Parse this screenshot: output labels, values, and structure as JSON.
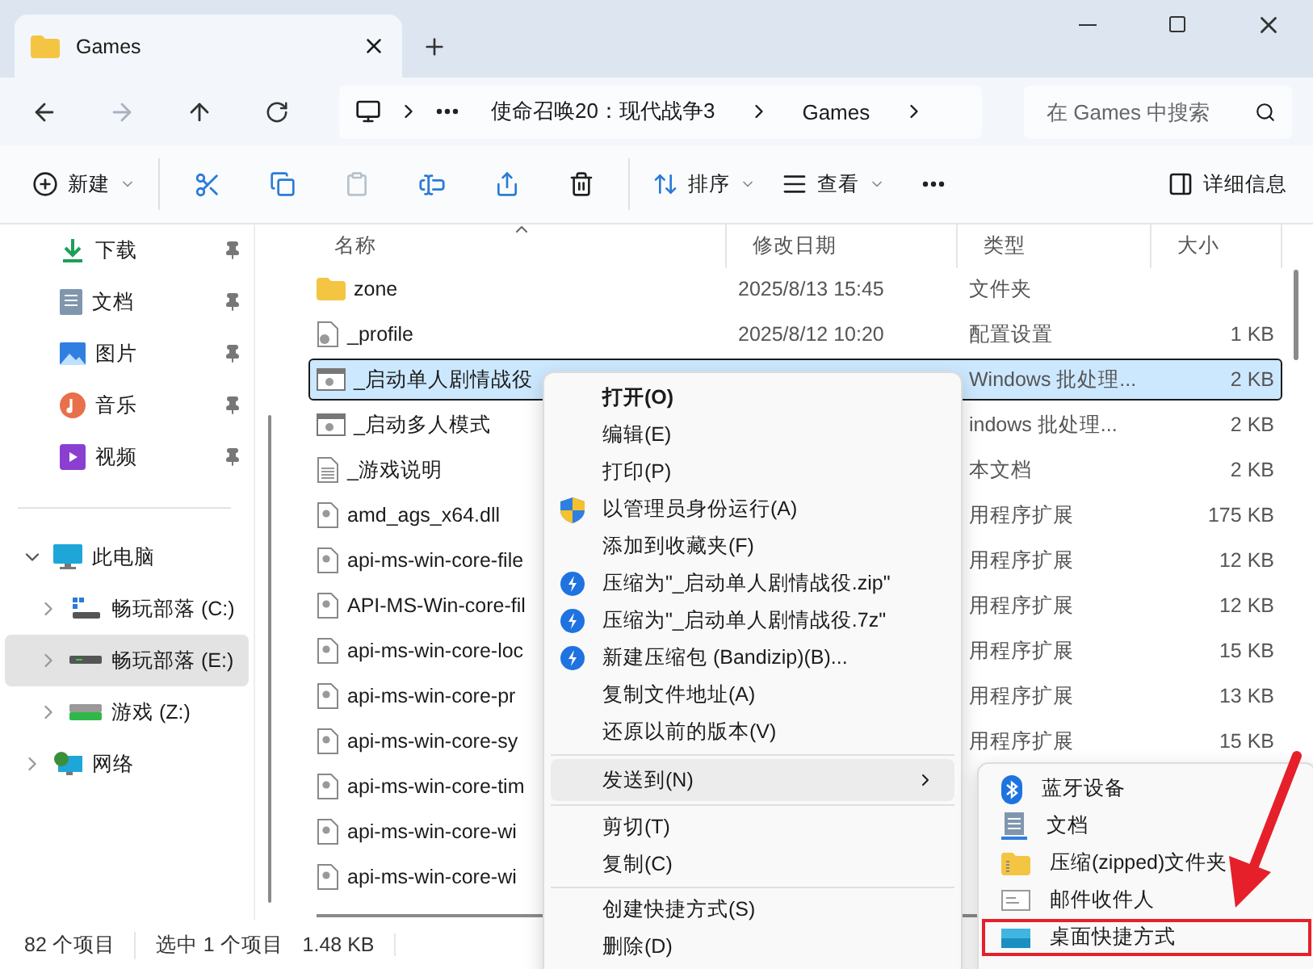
{
  "window": {
    "tabs": [
      {
        "title": "Games",
        "selected": true
      }
    ]
  },
  "nav_buttons": [
    {
      "kind": "back",
      "disabled": false
    },
    {
      "kind": "forward",
      "disabled": true
    },
    {
      "kind": "up",
      "disabled": false
    },
    {
      "kind": "refresh",
      "disabled": false
    }
  ],
  "address": {
    "path": [
      "使命召唤20：现代战争3",
      "Games"
    ]
  },
  "search": {
    "placeholder": "在 Games 中搜索"
  },
  "toolbar": {
    "items": [
      {
        "kind": "new",
        "label": "新建",
        "dropdown": true,
        "disabled": false
      },
      {
        "kind": "separator"
      },
      {
        "kind": "cut",
        "disabled": false
      },
      {
        "kind": "copy",
        "disabled": false
      },
      {
        "kind": "paste",
        "disabled": true
      },
      {
        "kind": "rename",
        "disabled": false
      },
      {
        "kind": "share",
        "disabled": false
      },
      {
        "kind": "delete",
        "disabled": false
      },
      {
        "kind": "separator"
      },
      {
        "kind": "sort",
        "label": "排序",
        "dropdown": true,
        "disabled": false
      },
      {
        "kind": "view",
        "label": "查看",
        "dropdown": true,
        "disabled": false
      },
      {
        "kind": "more",
        "disabled": false
      }
    ],
    "details": "详细信息"
  },
  "sidebar": {
    "quick_access": [
      {
        "label": "下载",
        "kind": "download",
        "pinned": true
      },
      {
        "label": "文档",
        "kind": "documents",
        "pinned": true
      },
      {
        "label": "图片",
        "kind": "pictures",
        "pinned": true
      },
      {
        "label": "音乐",
        "kind": "music",
        "pinned": true
      },
      {
        "label": "视频",
        "kind": "video",
        "pinned": true
      }
    ],
    "tree": [
      {
        "label": "此电脑",
        "kind": "pc",
        "expanded": true,
        "selected": false,
        "children": [
          {
            "label": "畅玩部落 (C:)",
            "kind": "system-drive",
            "expanded": false,
            "selected": false
          },
          {
            "label": "畅玩部落 (E:)",
            "kind": "drive",
            "expanded": false,
            "selected": true
          },
          {
            "label": "游戏 (Z:)",
            "kind": "green-drive",
            "expanded": false,
            "selected": false
          }
        ]
      },
      {
        "label": "网络",
        "kind": "network",
        "expanded": false,
        "selected": false
      }
    ]
  },
  "files": {
    "columns": [
      {
        "label": "名称",
        "sorted": true
      },
      {
        "label": "修改日期",
        "sorted": false
      },
      {
        "label": "类型",
        "sorted": false
      },
      {
        "label": "大小",
        "sorted": false
      }
    ],
    "rows": [
      {
        "name": "zone",
        "kind": "folder",
        "date": "2025/8/13 15:45",
        "type": "文件夹",
        "selected": false
      },
      {
        "name": "_profile",
        "kind": "settings",
        "date": "2025/8/12 10:20",
        "type": "配置设置",
        "size": "1 KB",
        "selected": false
      },
      {
        "name": "_启动单人剧情战役",
        "kind": "batch",
        "type": "Windows 批处理...",
        "size": "2 KB",
        "selected": true
      },
      {
        "name": "_启动多人模式",
        "kind": "batch",
        "type": "indows 批处理...",
        "size": "2 KB",
        "selected": false
      },
      {
        "name": "_游戏说明",
        "kind": "text",
        "type": "本文档",
        "size": "2 KB",
        "selected": false
      },
      {
        "name": "amd_ags_x64.dll",
        "kind": "dll",
        "type": "用程序扩展",
        "size": "175 KB",
        "selected": false
      },
      {
        "name": "api-ms-win-core-file",
        "kind": "dll",
        "type": "用程序扩展",
        "size": "12 KB",
        "selected": false
      },
      {
        "name": "API-MS-Win-core-fil",
        "kind": "dll",
        "type": "用程序扩展",
        "size": "12 KB",
        "selected": false
      },
      {
        "name": "api-ms-win-core-loc",
        "kind": "dll",
        "type": "用程序扩展",
        "size": "15 KB",
        "selected": false
      },
      {
        "name": "api-ms-win-core-pr",
        "kind": "dll",
        "type": "用程序扩展",
        "size": "13 KB",
        "selected": false
      },
      {
        "name": "api-ms-win-core-sy",
        "kind": "dll",
        "type": "用程序扩展",
        "size": "15 KB",
        "selected": false
      },
      {
        "name": "api-ms-win-core-tim",
        "kind": "dll",
        "selected": false
      },
      {
        "name": "api-ms-win-core-wi",
        "kind": "dll",
        "selected": false
      },
      {
        "name": "api-ms-win-core-wi",
        "kind": "dll",
        "selected": false
      }
    ]
  },
  "context_menu": {
    "items": [
      {
        "kind": "plain",
        "label": "打开(O)",
        "default": true
      },
      {
        "kind": "plain",
        "label": "编辑(E)",
        "default": false
      },
      {
        "kind": "plain",
        "label": "打印(P)",
        "default": false
      },
      {
        "kind": "shield",
        "label": "以管理员身份运行(A)",
        "default": false
      },
      {
        "kind": "plain",
        "label": "添加到收藏夹(F)",
        "default": false
      },
      {
        "kind": "bandizip",
        "label": "压缩为\"_启动单人剧情战役.zip\"",
        "default": false
      },
      {
        "kind": "bandizip",
        "label": "压缩为\"_启动单人剧情战役.7z\"",
        "default": false
      },
      {
        "kind": "bandizip",
        "label": "新建压缩包 (Bandizip)(B)...",
        "default": false
      },
      {
        "kind": "plain",
        "label": "复制文件地址(A)",
        "default": false
      },
      {
        "kind": "plain",
        "label": "还原以前的版本(V)",
        "default": false
      },
      {
        "kind": "separator"
      },
      {
        "kind": "submenu",
        "label": "发送到(N)",
        "selected": true
      },
      {
        "kind": "separator"
      },
      {
        "kind": "plain",
        "label": "剪切(T)",
        "default": false
      },
      {
        "kind": "plain",
        "label": "复制(C)",
        "default": false
      },
      {
        "kind": "separator"
      },
      {
        "kind": "plain",
        "label": "创建快捷方式(S)",
        "default": false
      },
      {
        "kind": "plain",
        "label": "删除(D)",
        "default": false
      }
    ]
  },
  "send_to_menu": {
    "items": [
      {
        "label": "蓝牙设备",
        "kind": "bluetooth",
        "annotated": false
      },
      {
        "label": "文档",
        "kind": "documents",
        "annotated": false
      },
      {
        "label": "压缩(zipped)文件夹",
        "kind": "zip-folder",
        "annotated": false
      },
      {
        "label": "邮件收件人",
        "kind": "mail",
        "annotated": false
      },
      {
        "label": "桌面快捷方式",
        "kind": "desktop",
        "annotated": true
      }
    ]
  },
  "status_bar": {
    "item_count": "82 个项目",
    "selection": "选中 1 个项目",
    "size": "1.48 KB"
  }
}
